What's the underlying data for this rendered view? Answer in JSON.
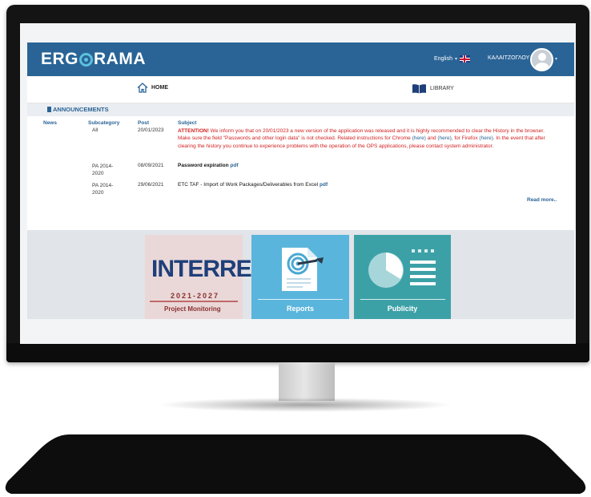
{
  "app": {
    "logo": {
      "part1": "ERG",
      "part2": "RAMA"
    },
    "language": "English",
    "user_name": "ΚΑΛΑΙΤΖΟΓΛΟΥ"
  },
  "nav": {
    "home": "HOME",
    "library": "LIBRARY"
  },
  "announcements": {
    "title": "ANNOUNCEMENTS",
    "headers": {
      "news": "News",
      "subcategory": "Subcategory",
      "post": "Post",
      "subject": "Subject"
    },
    "rows": [
      {
        "subcategory": "All",
        "post": "20/01/2023",
        "subject_prefix": "ATTENTION!",
        "subject_part1": " We inform you that on 20/01/2023 a new version of the application was released and it is highly recommended to clear the History in the browser. Make sure the field \"Passwords and other login data\" is not checked. Related instructions for Chrome ",
        "link_here_1": "(here)",
        "subject_and": " and ",
        "link_here_2": "(here)",
        "subject_for_ff": ", for Firefox ",
        "link_here_3": "(here)",
        "subject_part2": ". In the event that after clearing the history you continue to experience problems with the operation of the OPS applications, please contact system administrator."
      },
      {
        "subcategory": "PA 2014-2020",
        "post": "08/09/2021",
        "subject": "Password expiration",
        "link": "pdf"
      },
      {
        "subcategory": "PA 2014-2020",
        "post": "29/06/2021",
        "subject": "ETC TAF - Import of Work Packages/Deliverables from Excel",
        "link": "pdf"
      }
    ],
    "read_more": "Read more.."
  },
  "tiles": {
    "interreg": {
      "brand": "INTERREG",
      "years": "2021-2027",
      "label": "Project Monitoring"
    },
    "reports": {
      "label": "Reports"
    },
    "publicity": {
      "label": "Publicity"
    }
  },
  "colors": {
    "header_blue": "#2a6496",
    "accent_cyan": "#5bc0de",
    "attention_red": "#d21f1f",
    "tile_reports": "#5ab5dc",
    "tile_publicity": "#3ca1a7"
  }
}
